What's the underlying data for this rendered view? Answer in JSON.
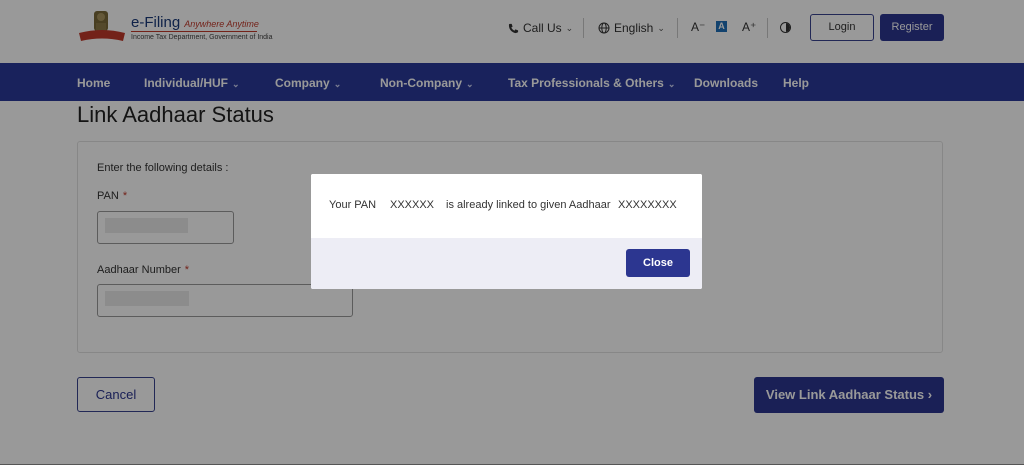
{
  "header": {
    "brand": "e-Filing",
    "tagline": "Anywhere Anytime",
    "subtitle": "Income Tax Department, Government of India",
    "call_us": "Call Us",
    "language": "English",
    "font_decrease": "A⁻",
    "font_normal": "A",
    "font_increase": "A⁺",
    "login": "Login",
    "register": "Register"
  },
  "nav": {
    "items": [
      {
        "label": "Home"
      },
      {
        "label": "Individual/HUF"
      },
      {
        "label": "Company"
      },
      {
        "label": "Non-Company"
      },
      {
        "label": "Tax Professionals & Others"
      },
      {
        "label": "Downloads"
      },
      {
        "label": "Help"
      }
    ]
  },
  "page": {
    "title": "Link Aadhaar Status",
    "hint": "Enter the following details :",
    "pan_label": "PAN",
    "aadhaar_label": "Aadhaar Number",
    "required_mark": "*",
    "cancel": "Cancel",
    "view_status": "View Link Aadhaar Status"
  },
  "modal": {
    "part1": "Your PAN",
    "pan": "XXXXXX",
    "part2": "is already linked to given Aadhaar",
    "aadhaar": "XXXXXXXX",
    "close": "Close"
  },
  "colors": {
    "primary": "#2c3690",
    "nav_bg": "#2b3a9a",
    "required": "#c0392b"
  }
}
